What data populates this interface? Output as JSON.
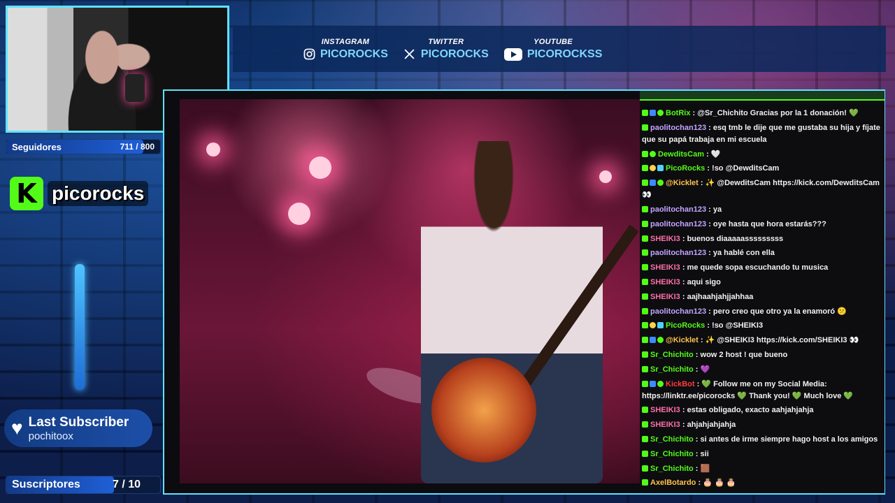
{
  "socials": [
    {
      "network": "INSTAGRAM",
      "handle": "PICOROCKS",
      "icon": "instagram-icon"
    },
    {
      "network": "TWITTER",
      "handle": "PICOROCKS",
      "icon": "x-icon"
    },
    {
      "network": "YOUTUBE",
      "handle": "PICOROCKSS",
      "icon": "youtube-icon"
    }
  ],
  "followers": {
    "label": "Seguidores",
    "value": "711 / 800",
    "progress": 0.89
  },
  "logo": {
    "name": "picorocks",
    "icon": "kick-logo-icon"
  },
  "last_subscriber": {
    "title": "Last Subscriber",
    "value": "pochitoox",
    "icon": "heart-icon"
  },
  "subscribers": {
    "label": "Suscriptores",
    "value": "7 / 10",
    "progress": 0.7
  },
  "colors": {
    "accent": "#5fe3ff",
    "kick_green": "#53fc18",
    "panel_blue": "#123b82"
  },
  "chat": [
    {
      "badges": [
        "kick",
        "mod",
        "ver"
      ],
      "user": "BotRix",
      "color": "#53fc18",
      "text": "@Sr_Chichito Gracias por la 1 donación! 💚"
    },
    {
      "badges": [
        "kick"
      ],
      "user": "paolitochan123",
      "color": "#c3a4ff",
      "text": "esq tmb le dije que me gustaba su hija y fíjate que su papá trabaja en mi escuela"
    },
    {
      "badges": [
        "kick",
        "ver"
      ],
      "user": "DewditsCam",
      "color": "#53fc18",
      "text": "🤍"
    },
    {
      "badges": [
        "kick",
        "star",
        "bot"
      ],
      "user": "PicoRocks",
      "color": "#53fc18",
      "text": "!so @DewditsCam"
    },
    {
      "badges": [
        "kick",
        "mod",
        "ver"
      ],
      "user": "@Kicklet",
      "color": "#ffc24a",
      "text": "✨ @DewditsCam https://kick.com/DewditsCam 👀"
    },
    {
      "badges": [
        "kick"
      ],
      "user": "paolitochan123",
      "color": "#c3a4ff",
      "text": "ya"
    },
    {
      "badges": [
        "kick"
      ],
      "user": "paolitochan123",
      "color": "#c3a4ff",
      "text": "oye hasta que hora estarás???"
    },
    {
      "badges": [
        "kick"
      ],
      "user": "SHEIKI3",
      "color": "#ff6fa8",
      "text": "buenos diaaaaasssssssss"
    },
    {
      "badges": [
        "kick"
      ],
      "user": "paolitochan123",
      "color": "#c3a4ff",
      "text": "ya hablé con ella"
    },
    {
      "badges": [
        "kick"
      ],
      "user": "SHEIKI3",
      "color": "#ff6fa8",
      "text": "me quede sopa escuchando tu musica"
    },
    {
      "badges": [
        "kick"
      ],
      "user": "SHEIKI3",
      "color": "#ff6fa8",
      "text": "aqui sigo"
    },
    {
      "badges": [
        "kick"
      ],
      "user": "SHEIKI3",
      "color": "#ff6fa8",
      "text": "aajhaahjahjjahhaa"
    },
    {
      "badges": [
        "kick"
      ],
      "user": "paolitochan123",
      "color": "#c3a4ff",
      "text": "pero creo que otro ya la enamoró 😕"
    },
    {
      "badges": [
        "kick",
        "star",
        "bot"
      ],
      "user": "PicoRocks",
      "color": "#53fc18",
      "text": "!so @SHEIKI3"
    },
    {
      "badges": [
        "kick",
        "mod",
        "ver"
      ],
      "user": "@Kicklet",
      "color": "#ffc24a",
      "text": "✨ @SHEIKI3 https://kick.com/SHEIKI3 👀"
    },
    {
      "badges": [
        "kick"
      ],
      "user": "Sr_Chichito",
      "color": "#53fc18",
      "text": "wow 2 host ! que bueno"
    },
    {
      "badges": [
        "kick"
      ],
      "user": "Sr_Chichito",
      "color": "#53fc18",
      "text": "💜"
    },
    {
      "badges": [
        "kick",
        "mod",
        "ver"
      ],
      "user": "KickBot",
      "color": "#ff3b3b",
      "text": "💚 Follow me on my Social Media: https://linktr.ee/picorocks 💚 Thank you! 💚 Much love 💚"
    },
    {
      "badges": [
        "kick"
      ],
      "user": "SHEIKI3",
      "color": "#ff6fa8",
      "text": "estas obligado, exacto aahjahjahja"
    },
    {
      "badges": [
        "kick"
      ],
      "user": "SHEIKI3",
      "color": "#ff6fa8",
      "text": "ahjahjahjahja"
    },
    {
      "badges": [
        "kick"
      ],
      "user": "Sr_Chichito",
      "color": "#53fc18",
      "text": "si antes de irme siempre hago host a los amigos"
    },
    {
      "badges": [
        "kick"
      ],
      "user": "Sr_Chichito",
      "color": "#53fc18",
      "text": "sii"
    },
    {
      "badges": [
        "kick"
      ],
      "user": "Sr_Chichito",
      "color": "#53fc18",
      "text": "🟫"
    },
    {
      "badges": [
        "kick"
      ],
      "user": "AxelBotardo",
      "color": "#ffc24a",
      "text": "🎂 🎂 🎂"
    }
  ]
}
